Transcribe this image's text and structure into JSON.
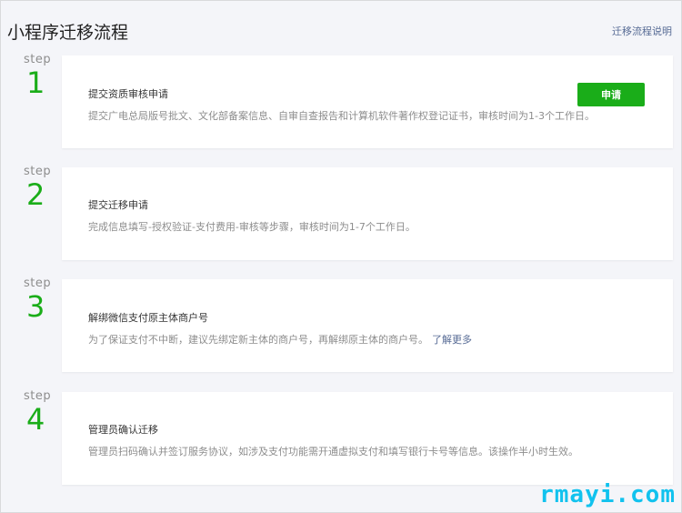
{
  "header": {
    "title": "小程序迁移流程",
    "help_link": "迁移流程说明"
  },
  "step_label": "step",
  "steps": [
    {
      "number": "1",
      "title": "提交资质审核申请",
      "description": "提交广电总局版号批文、文化部备案信息、自审自查报告和计算机软件著作权登记证书，审核时间为1-3个工作日。",
      "button_label": "申请"
    },
    {
      "number": "2",
      "title": "提交迁移申请",
      "description": "完成信息填写-授权验证-支付费用-审核等步骤，审核时间为1-7个工作日。"
    },
    {
      "number": "3",
      "title": "解绑微信支付原主体商户号",
      "description": "为了保证支付不中断，建议先绑定新主体的商户号，再解绑原主体的商户号。",
      "link": "了解更多"
    },
    {
      "number": "4",
      "title": "管理员确认迁移",
      "description": "管理员扫码确认并签订服务协议，如涉及支付功能需开通虚拟支付和填写银行卡号等信息。该操作半小时生效。"
    }
  ],
  "watermark": "rmayi.com",
  "colors": {
    "accent": "#1aad19",
    "link": "#576b95",
    "watermark": "#11c2ee"
  }
}
